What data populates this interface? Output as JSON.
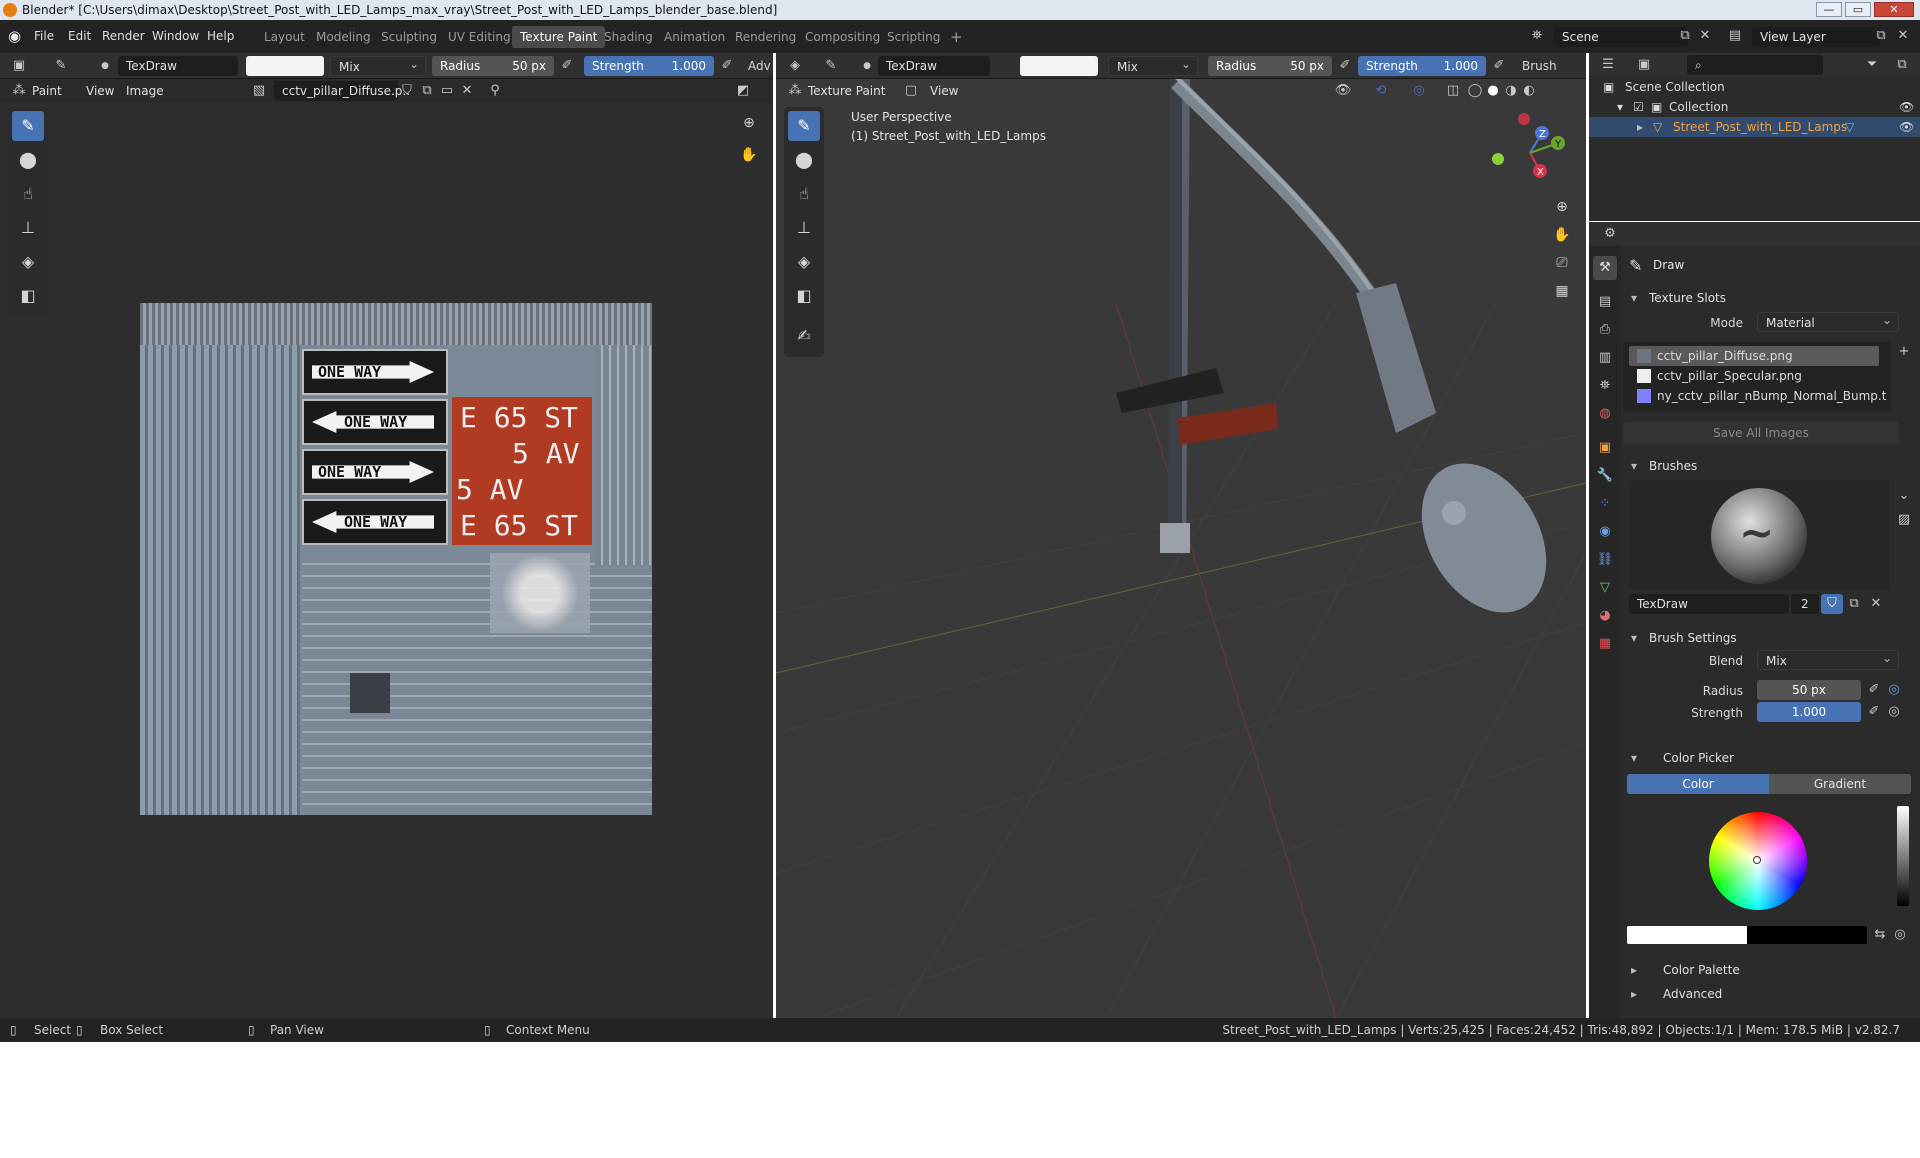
{
  "window": {
    "title": "Blender* [C:\\Users\\dimax\\Desktop\\Street_Post_with_LED_Lamps_max_vray\\Street_Post_with_LED_Lamps_blender_base.blend]",
    "minimize": "—",
    "maximize": "▭",
    "close": "✕"
  },
  "menu": [
    "File",
    "Edit",
    "Render",
    "Window",
    "Help"
  ],
  "workspaces": [
    "Layout",
    "Modeling",
    "Sculpting",
    "UV Editing",
    "Texture Paint",
    "Shading",
    "Animation",
    "Rendering",
    "Compositing",
    "Scripting"
  ],
  "workspace_active": "Texture Paint",
  "workspace_add": "+",
  "scene": {
    "name": "Scene",
    "view_layer": "View Layer"
  },
  "image_editor": {
    "brush_name": "TexDraw",
    "blend": "Mix",
    "radius_label": "Radius",
    "radius_value": "50 px",
    "strength_label": "Strength",
    "strength_value": "1.000",
    "adv": "Adv",
    "mode": "Paint",
    "menus": [
      "View",
      "Image"
    ],
    "image_name": "cctv_pillar_Diffuse.p..",
    "texture_signs": {
      "one_way_labels": [
        "ONE WAY",
        "ONE WAY",
        "ONE WAY",
        "ONE WAY"
      ],
      "street_labels": [
        "E 65 ST",
        "5 AV",
        "5 AV",
        "E 65 ST"
      ]
    }
  },
  "viewport": {
    "brush_name": "TexDraw",
    "blend": "Mix",
    "radius_label": "Radius",
    "radius_value": "50 px",
    "strength_label": "Strength",
    "strength_value": "1.000",
    "brush_menu": "Brush",
    "mode": "Texture Paint",
    "view_menu": "View",
    "perspective": "User Perspective",
    "object_label": "(1) Street_Post_with_LED_Lamps",
    "gizmo": {
      "z": "Z",
      "y": "Y",
      "x": "X"
    }
  },
  "outliner": {
    "scene_collection": "Scene Collection",
    "collection": "Collection",
    "object": "Street_Post_with_LED_Lamps"
  },
  "properties": {
    "tool_name": "Draw",
    "texture_slots": {
      "header": "Texture Slots",
      "mode_label": "Mode",
      "mode_value": "Material",
      "slots": [
        {
          "name": "cctv_pillar_Diffuse.png",
          "swatch": "#6d7680"
        },
        {
          "name": "cctv_pillar_Specular.png",
          "swatch": "#f0f0f0"
        },
        {
          "name": "ny_cctv_pillar_nBump_Normal_Bump.tga",
          "swatch": "#8080ff"
        }
      ],
      "save_all": "Save All Images"
    },
    "brushes": {
      "header": "Brushes",
      "brush_name": "TexDraw",
      "users": "2"
    },
    "brush_settings": {
      "header": "Brush Settings",
      "blend_label": "Blend",
      "blend_value": "Mix",
      "radius_label": "Radius",
      "radius_value": "50 px",
      "strength_label": "Strength",
      "strength_value": "1.000",
      "color_picker": "Color Picker",
      "color_tab": "Color",
      "gradient_tab": "Gradient",
      "color_palette": "Color Palette",
      "advanced": "Advanced"
    }
  },
  "statusbar": {
    "select": "Select",
    "box_select": "Box Select",
    "pan_view": "Pan View",
    "context_menu": "Context Menu",
    "stats": "Street_Post_with_LED_Lamps | Verts:25,425 | Faces:24,452 | Tris:48,892 | Objects:1/1 | Mem: 178.5 MiB | v2.82.7"
  },
  "colors": {
    "accent": "#4772b3",
    "header_bg": "#232323",
    "editor_bg": "#2e2e2e",
    "viewport_bg": "#393939",
    "sign_red": "#b13a22"
  }
}
